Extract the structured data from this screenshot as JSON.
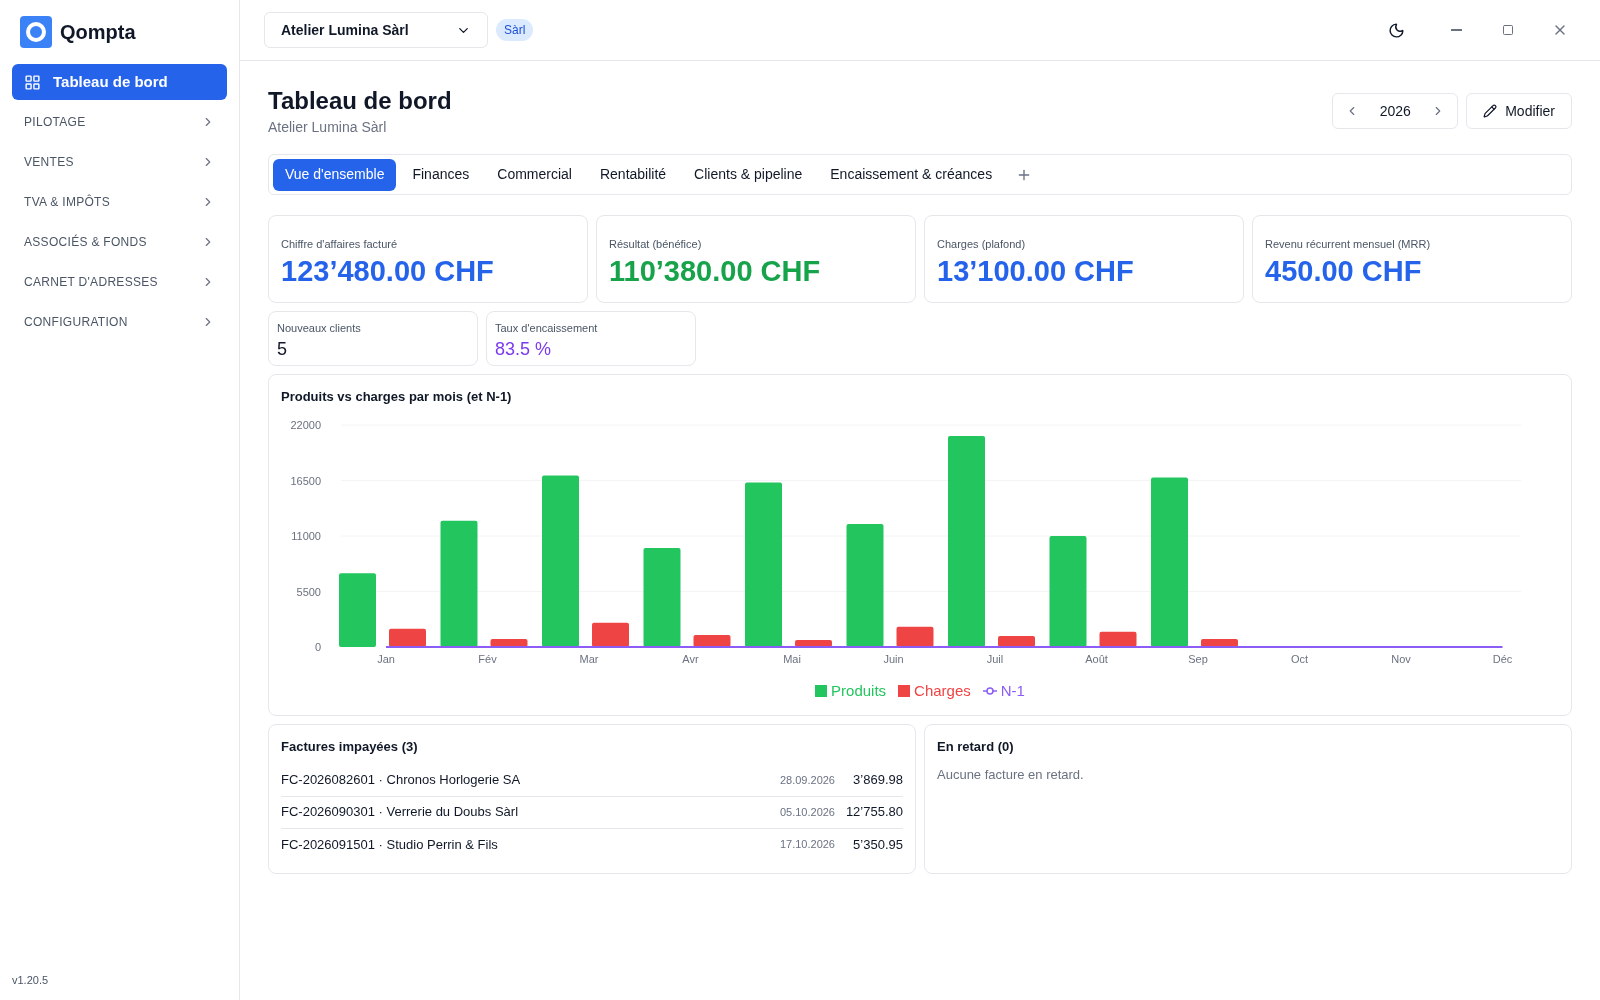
{
  "app": {
    "name": "Qompta",
    "version": "v1.20.5"
  },
  "sidebar": {
    "items": [
      {
        "label": "Tableau de bord",
        "kind": "link",
        "selected": true
      },
      {
        "label": "PILOTAGE",
        "kind": "section",
        "selected": false
      },
      {
        "label": "VENTES",
        "kind": "section",
        "selected": false
      },
      {
        "label": "TVA & IMPÔTS",
        "kind": "section",
        "selected": false
      },
      {
        "label": "ASSOCIÉS & FONDS",
        "kind": "section",
        "selected": false
      },
      {
        "label": "CARNET D'ADRESSES",
        "kind": "section",
        "selected": false
      },
      {
        "label": "CONFIGURATION",
        "kind": "section",
        "selected": false
      }
    ]
  },
  "topbar": {
    "company_select": {
      "value": "Atelier Lumina Sàrl"
    },
    "badge": "Sàrl"
  },
  "header": {
    "title": "Tableau de bord",
    "subtitle": "Atelier Lumina Sàrl",
    "year": "2026",
    "edit_button": "Modifier"
  },
  "tabs": [
    {
      "label": "Vue d'ensemble",
      "selected": true
    },
    {
      "label": "Finances",
      "selected": false
    },
    {
      "label": "Commercial",
      "selected": false
    },
    {
      "label": "Rentabilité",
      "selected": false
    },
    {
      "label": "Clients & pipeline",
      "selected": false
    },
    {
      "label": "Encaissement & créances",
      "selected": false
    }
  ],
  "kpis": [
    {
      "label": "Chiffre d'affaires facturé",
      "value": "123’480.00 CHF",
      "color": "#2563eb"
    },
    {
      "label": "Résultat (bénéfice)",
      "value": "110’380.00 CHF",
      "color": "#16a34a"
    },
    {
      "label": "Charges (plafond)",
      "value": "13’100.00 CHF",
      "color": "#2563eb"
    },
    {
      "label": "Revenu récurrent mensuel (MRR)",
      "value": "450.00 CHF",
      "color": "#2563eb"
    }
  ],
  "small_kpis": [
    {
      "label": "Nouveaux clients",
      "value": "5",
      "color": "#111827"
    },
    {
      "label": "Taux d'encaissement",
      "value": "83.5 %",
      "color": "#7c3aed"
    }
  ],
  "chart": {
    "chart_data": {
      "type": "bar",
      "title": "Produits vs charges par mois (et N-1)",
      "categories": [
        "Jan",
        "Fév",
        "Mar",
        "Avr",
        "Mai",
        "Juin",
        "Juil",
        "Août",
        "Sep",
        "Oct",
        "Nov",
        "Déc"
      ],
      "series": [
        {
          "name": "Produits",
          "color": "#22c55e",
          "values": [
            7300,
            12500,
            17000,
            9800,
            16300,
            12200,
            20900,
            11000,
            16800,
            null,
            null,
            null
          ]
        },
        {
          "name": "Charges",
          "color": "#ef4444",
          "values": [
            1800,
            800,
            2400,
            1200,
            700,
            2000,
            1100,
            1500,
            800,
            null,
            null,
            null
          ]
        },
        {
          "name": "N-1",
          "color": "#8b5cf6",
          "values": [
            0,
            0,
            0,
            0,
            0,
            0,
            0,
            0,
            0,
            0,
            0,
            0
          ]
        }
      ],
      "grid": true,
      "ylim": [
        0,
        22000
      ],
      "yticks": [
        0,
        5500,
        11000,
        16500,
        22000
      ]
    }
  },
  "unpaid": {
    "title": "Factures impayées (3)",
    "rows": [
      {
        "invoice": "FC-2026082601 · Chronos Horlogerie SA",
        "date": "28.09.2026",
        "amount": "3’869.98"
      },
      {
        "invoice": "FC-2026090301 · Verrerie du Doubs Sàrl",
        "date": "05.10.2026",
        "amount": "12’755.80"
      },
      {
        "invoice": "FC-2026091501 · Studio Perrin & Fils",
        "date": "17.10.2026",
        "amount": "5’350.95"
      }
    ]
  },
  "overdue": {
    "title": "En retard (0)",
    "message": "Aucune facture en retard."
  }
}
